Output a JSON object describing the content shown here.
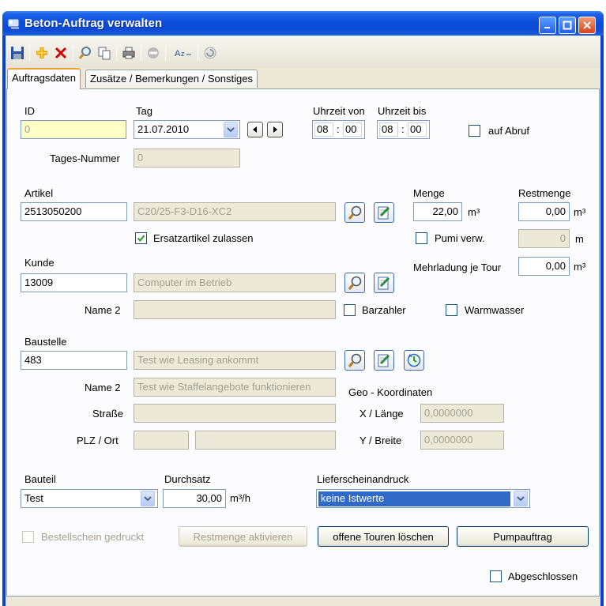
{
  "window": {
    "title": "Beton-Auftrag verwalten"
  },
  "tabs": [
    "Auftragsdaten",
    "Zusätze / Bemerkungen / Sonstiges"
  ],
  "labels": {
    "id": "ID",
    "tag": "Tag",
    "uhrzeit_von": "Uhrzeit von",
    "uhrzeit_bis": "Uhrzeit bis",
    "auf_abruf": "auf Abruf",
    "tages_nummer": "Tages-Nummer",
    "artikel": "Artikel",
    "menge": "Menge",
    "restmenge": "Restmenge",
    "ersatzartikel": "Ersatzartikel zulassen",
    "pumi": "Pumi verw.",
    "kunde": "Kunde",
    "mehrladung": "Mehrladung je Tour",
    "name2": "Name 2",
    "barzahler": "Barzahler",
    "warmwasser": "Warmwasser",
    "baustelle": "Baustelle",
    "geo": "Geo - Koordinaten",
    "strasse": "Straße",
    "x_laenge": "X / Länge",
    "plz_ort": "PLZ / Ort",
    "y_breite": "Y / Breite",
    "bauteil": "Bauteil",
    "durchsatz": "Durchsatz",
    "lieferschein": "Lieferscheinandruck",
    "bestellschein": "Bestellschein gedruckt",
    "abgeschlossen": "Abgeschlossen",
    "unit_m3": "m³",
    "unit_m": "m",
    "unit_m3h": "m³/h",
    "time_sep": ":"
  },
  "values": {
    "id": "0",
    "tag": "21.07.2010",
    "von_h": "08",
    "von_m": "00",
    "bis_h": "08",
    "bis_m": "00",
    "tages_nummer": "0",
    "artikel_nr": "2513050200",
    "artikel_name": "C20/25-F3-D16-XC2",
    "menge": "22,00",
    "restmenge": "0,00",
    "pumi": "0",
    "mehrladung": "0,00",
    "kunde_nr": "13009",
    "kunde_name": "Computer im Betrieb",
    "kunde_name2": "",
    "baustelle_nr": "483",
    "baustelle_name": "Test wie Leasing ankommt",
    "baustelle_name2": "Test wie Staffelangebote funktionieren",
    "strasse": "",
    "plz": "",
    "ort": "",
    "x_laenge": "0,0000000",
    "y_breite": "0,0000000",
    "bauteil": "Test",
    "durchsatz": "30,00",
    "lieferschein": "keine Istwerte"
  },
  "checks": {
    "auf_abruf": false,
    "ersatzartikel": true,
    "pumi": false,
    "barzahler": false,
    "warmwasser": false,
    "bestellschein": false,
    "abgeschlossen": false
  },
  "buttons": {
    "restmenge": "Restmenge aktivieren",
    "touren": "offene Touren löschen",
    "pumpauftrag": "Pumpauftrag"
  },
  "colors": {
    "title_blue": "#0a4ede",
    "input_yellow": "#ffffc6",
    "select_blue": "#316ac5"
  }
}
